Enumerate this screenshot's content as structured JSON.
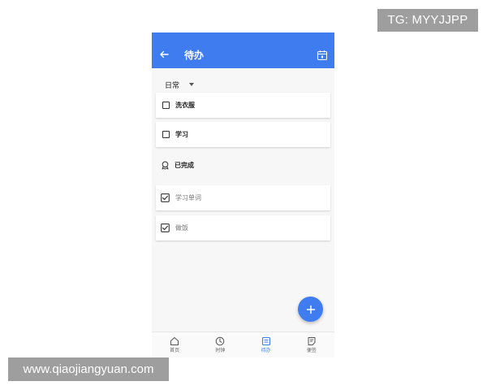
{
  "watermarks": {
    "top": "TG: MYYJJPP",
    "bottom": "www.qiaojiangyuan.com"
  },
  "appbar": {
    "title": "待办",
    "back_icon": "arrow-left-icon",
    "action_icon": "calendar-icon"
  },
  "category": {
    "selected": "日常"
  },
  "todos": [
    {
      "label": "洗衣服",
      "checked": false
    },
    {
      "label": "学习",
      "checked": false
    }
  ],
  "completed": {
    "header": "已完成",
    "icon": "medal-icon",
    "items": [
      {
        "label": "学习单词",
        "checked": true
      },
      {
        "label": "做饭",
        "checked": true
      }
    ]
  },
  "fab": {
    "icon": "plus-icon"
  },
  "bottom_nav": [
    {
      "label": "首页",
      "icon": "home-icon",
      "active": false
    },
    {
      "label": "时钟",
      "icon": "clock-icon",
      "active": false
    },
    {
      "label": "待办",
      "icon": "todo-icon",
      "active": true
    },
    {
      "label": "便签",
      "icon": "note-icon",
      "active": false
    }
  ],
  "colors": {
    "accent": "#3f7cf0",
    "background": "#f7f7f7",
    "card": "#ffffff"
  }
}
